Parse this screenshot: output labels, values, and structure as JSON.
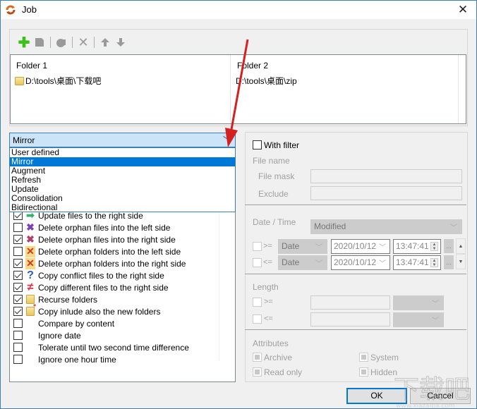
{
  "window": {
    "title": "Job",
    "close_icon": "close-icon"
  },
  "toolbar": {
    "buttons": [
      {
        "name": "add",
        "icon": "plus-icon",
        "glyph": "✚"
      },
      {
        "name": "edit",
        "icon": "edit-icon",
        "glyph": "▰"
      },
      {
        "name": "copy",
        "icon": "copy-icon",
        "glyph": "●"
      },
      {
        "name": "delete",
        "icon": "delete-icon",
        "glyph": "✕"
      },
      {
        "name": "move-up",
        "icon": "arrow-up-icon",
        "glyph": "🡅"
      },
      {
        "name": "move-down",
        "icon": "arrow-down-icon",
        "glyph": "🡇"
      }
    ]
  },
  "folders": {
    "header1": "Folder 1",
    "header2": "Folder 2",
    "path1": "D:\\tools\\桌面\\下载吧",
    "path2": "D:\\tools\\桌面\\zip"
  },
  "mode": {
    "selected": "Mirror",
    "options": [
      "User defined",
      "Mirror",
      "Augment",
      "Refresh",
      "Update",
      "Consolidation",
      "Bidirectional"
    ]
  },
  "options": [
    {
      "label": "Update files to the right side",
      "checked": true,
      "icon": "arrow-right-icon"
    },
    {
      "label": "Delete orphan files into the left side",
      "checked": false,
      "icon": "delete-left-icon"
    },
    {
      "label": "Delete orphan files into the right side",
      "checked": true,
      "icon": "delete-right-icon"
    },
    {
      "label": "Delete orphan folders into the left side",
      "checked": false,
      "icon": "delete-folder-icon"
    },
    {
      "label": "Delete orphan folders into the right side",
      "checked": true,
      "icon": "delete-folder-icon"
    },
    {
      "label": "Copy conflict files to the right side",
      "checked": true,
      "icon": "question-icon"
    },
    {
      "label": "Copy different files to the right side",
      "checked": true,
      "icon": "not-equal-icon"
    },
    {
      "label": "Recurse folders",
      "checked": true,
      "icon": "folder-icon"
    },
    {
      "label": "Copy inlude also the new folders",
      "checked": true,
      "icon": "new-folder-icon"
    },
    {
      "label": "Compare by content",
      "checked": false,
      "icon": ""
    },
    {
      "label": "Ignore date",
      "checked": false,
      "icon": ""
    },
    {
      "label": "Tolerate until two second time difference",
      "checked": false,
      "icon": ""
    },
    {
      "label": "Ignore one hour time",
      "checked": false,
      "icon": ""
    }
  ],
  "filter": {
    "with_filter_label": "With filter",
    "with_filter_checked": false,
    "file_name_label": "File name",
    "file_mask_label": "File mask",
    "file_mask_value": "",
    "exclude_label": "Exclude",
    "exclude_value": "",
    "datetime_label": "Date / Time",
    "datetime_type": "Modified",
    "ge_label": ">=",
    "le_label": "<=",
    "date_mode": "Date",
    "date1": "2020/10/12",
    "time1": "13:47:41",
    "date2": "2020/10/12",
    "time2": "13:47:41",
    "ellipsis": "...",
    "length_label": "Length",
    "attributes_label": "Attributes",
    "attr_archive": "Archive",
    "attr_system": "System",
    "attr_readonly": "Read only",
    "attr_hidden": "Hidden"
  },
  "buttons": {
    "ok": "OK",
    "cancel": "Cancel"
  },
  "colors": {
    "accent": "#0078d7",
    "select_bg": "#cce4f7",
    "annotation_arrow": "#d42020"
  }
}
